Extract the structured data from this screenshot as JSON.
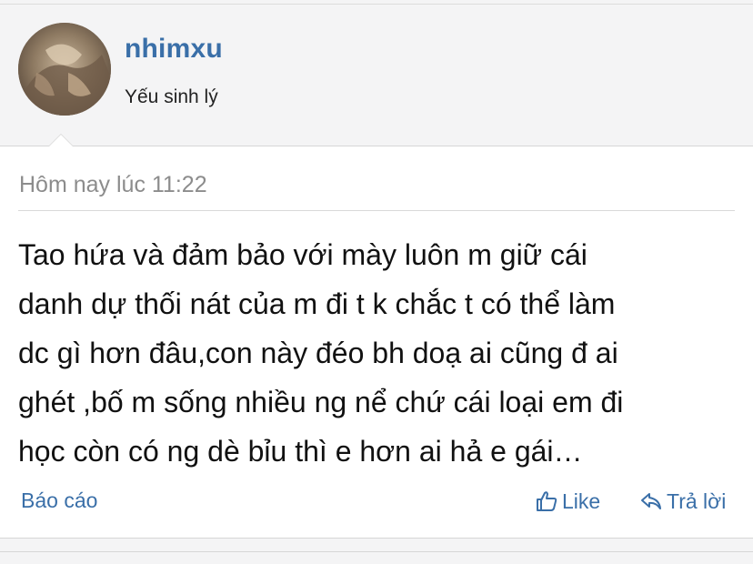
{
  "post": {
    "username": "nhimxu",
    "user_title": "Yếu sinh lý",
    "timestamp": "Hôm nay lúc 11:22",
    "message": "Tao hứa và đảm bảo với mày luôn m giữ cái\ndanh dự thối nát của m đi t k chắc t có thể làm\ndc gì hơn đâu,con này đéo bh doạ ai cũng đ ai\nghét ,bố m sống nhiều ng nể chứ cái loại em đi\nhọc còn có ng dè bỉu thì e hơn ai hả e gái…"
  },
  "actions": {
    "report_label": "Báo cáo",
    "like_label": "Like",
    "reply_label": "Trả lời"
  },
  "icons": {
    "like": "thumbs-up-icon",
    "reply": "reply-arrow-icon"
  },
  "colors": {
    "accent": "#3a6fa8",
    "background": "#f4f4f5",
    "card": "#ffffff",
    "muted": "#8c8c8c"
  }
}
